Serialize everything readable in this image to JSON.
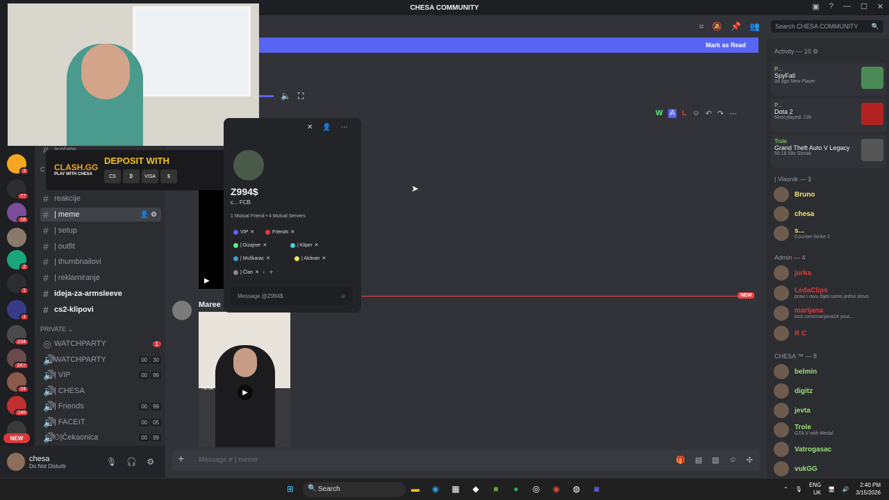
{
  "window": {
    "title": "CHESA COMMUNITY"
  },
  "servers": [
    {
      "badge": "3"
    },
    {
      "badge": "77"
    },
    {
      "badge": "18"
    },
    {
      "badge": ""
    },
    {
      "badge": "2"
    },
    {
      "badge": "1"
    },
    {
      "badge": "1"
    },
    {
      "badge": "234"
    },
    {
      "badge": "1K+"
    },
    {
      "badge": "24"
    },
    {
      "badge": "146"
    },
    {
      "badge": ""
    }
  ],
  "new_label": "NEW",
  "channels": {
    "items": [
      {
        "name": "isplate"
      },
      {
        "name": "reakcije"
      },
      {
        "name": "| meme"
      },
      {
        "name": "| setup"
      },
      {
        "name": "| outfit"
      },
      {
        "name": "| thumbnailovi"
      },
      {
        "name": "| reklamiranje"
      },
      {
        "name": "ideja-za-armsleeve"
      },
      {
        "name": "cs2-klipovi"
      }
    ],
    "category": "PRIVATE",
    "voice": [
      {
        "name": "WATCHPARTY",
        "badge": "1",
        "count": []
      },
      {
        "name": "WATCHPARTY",
        "badge": "",
        "count": [
          "00",
          "30"
        ]
      },
      {
        "name": "| VIP",
        "badge": "",
        "count": [
          "00",
          "99"
        ]
      },
      {
        "name": "| CHESA",
        "badge": "",
        "count": []
      },
      {
        "name": "| Friends",
        "badge": "",
        "count": [
          "00",
          "99"
        ]
      },
      {
        "name": "| FACEIT",
        "badge": "",
        "count": [
          "00",
          "05"
        ]
      },
      {
        "name": "⏱|Čekaonica",
        "badge": "",
        "count": [
          "00",
          "99"
        ]
      }
    ],
    "collapsed_label": "C"
  },
  "user": {
    "name": "chesa",
    "status": "Do Not Disturb"
  },
  "markbar": {
    "label": "Mark as Read"
  },
  "search": {
    "placeholder": "Search CHESA COMMUNITY"
  },
  "activity": {
    "header": "Activity — 10",
    "items": [
      {
        "user": "P...",
        "game": "SpyFall",
        "detail": "3d ago   New Player",
        "color": "#4b8a57"
      },
      {
        "user": "P...",
        "game": "Dota 2",
        "detail": "Most played: 13h",
        "color": "#b22222"
      },
      {
        "user": "Trole",
        "game": "Grand Theft Auto V Legacy",
        "detail": "56:18   58x Streak",
        "color": "#555"
      }
    ]
  },
  "members": {
    "vlasnik": {
      "header": "| Vlasnik — 3",
      "items": [
        {
          "name": "Bruno",
          "sub": "",
          "color": "#f5e663"
        },
        {
          "name": "chesa",
          "sub": "",
          "color": "#f5e663"
        },
        {
          "name": "s...",
          "sub": "Counter-Strike 2",
          "color": "#f5e663"
        }
      ]
    },
    "admin": {
      "header": "Admin — 4",
      "items": [
        {
          "name": "jurka",
          "sub": "",
          "color": "#e03a3a"
        },
        {
          "name": "LedaClips",
          "sub": "pravi i ravu dijeli samo jedno slovo",
          "color": "#e03a3a"
        },
        {
          "name": "marijana",
          "sub": "kick.com/marijana24 yout...",
          "color": "#e03a3a"
        },
        {
          "name": "R C",
          "sub": "",
          "color": "#e03a3a"
        }
      ]
    },
    "chesa": {
      "header": "CHESA ™ — 8",
      "items": [
        {
          "name": "belmin",
          "sub": "",
          "color": "#9be07a"
        },
        {
          "name": "digitz",
          "sub": "",
          "color": "#9be07a"
        },
        {
          "name": "jevta",
          "sub": "",
          "color": "#9be07a"
        },
        {
          "name": "Trole",
          "sub": "GTA V with Medal",
          "color": "#9be07a"
        },
        {
          "name": "Vatrogasac",
          "sub": "",
          "color": "#9be07a"
        },
        {
          "name": "vukGG",
          "sub": "",
          "color": "#9be07a"
        }
      ]
    }
  },
  "profile": {
    "name": "Z994$",
    "tag": "c...   FCB",
    "mutual": "1 Mutual Friend • 4 Mutual Servers",
    "roles": [
      {
        "label": "VIP",
        "color": "#5865f2"
      },
      {
        "label": "Friends",
        "color": "#e03a3a"
      },
      {
        "label": "| Dizajner",
        "color": "#57f287"
      },
      {
        "label": "| Kliper",
        "color": "#45d0e0"
      },
      {
        "label": "| Muškarac",
        "color": "#3aa0d0"
      },
      {
        "label": "| Aktivan",
        "color": "#f5e663"
      },
      {
        "label": "| Član",
        "color": "#8a8a8a"
      }
    ],
    "message_placeholder": "Message @Z994$"
  },
  "ad": {
    "brand": "CLASH.GG",
    "sub": "PLAY WITH CHESA",
    "headline": "DEPOSIT WITH",
    "logos": [
      "CS",
      "₿",
      "VISA",
      "$"
    ]
  },
  "messages": {
    "sender": "Maree",
    "new_tag": "NEW",
    "video_source": "TikTok"
  },
  "composer": {
    "placeholder": "Message # | meme"
  },
  "taskbar": {
    "search": "Search",
    "lang": "ENG",
    "region": "UK",
    "time": "2:40 PM",
    "date": "3/15/2026"
  }
}
